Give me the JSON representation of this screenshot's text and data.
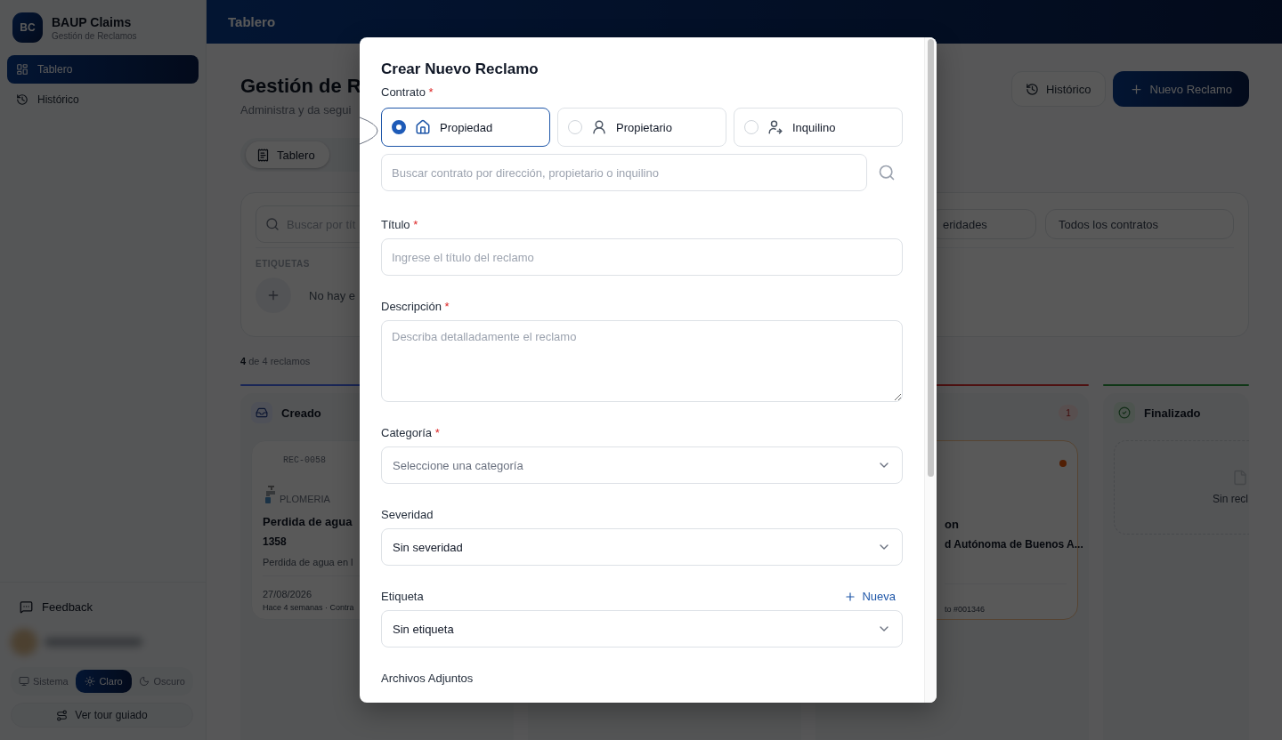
{
  "sidebar": {
    "logo": "BC",
    "app_name": "BAUP Claims",
    "app_subtitle": "Gestión de Reclamos",
    "nav": [
      {
        "label": "Tablero",
        "selected": true
      },
      {
        "label": "Histórico",
        "selected": false
      }
    ],
    "feedback": "Feedback",
    "theme_options": [
      {
        "label": "Sistema",
        "selected": false
      },
      {
        "label": "Claro",
        "selected": true
      },
      {
        "label": "Oscuro",
        "selected": false
      }
    ],
    "tour_button": "Ver tour guiado"
  },
  "header": {
    "title": "Tablero"
  },
  "page": {
    "title": "Gestión de R",
    "subtitle": "Administra y da segui",
    "actions": [
      {
        "label": "Histórico",
        "kind": "secondary"
      },
      {
        "label": "Nuevo Reclamo",
        "kind": "primary"
      }
    ],
    "view_tabs": [
      {
        "label": "Tablero",
        "selected": true
      }
    ],
    "filters": {
      "search_placeholder": "Buscar por tít",
      "chips": [
        "eridades",
        "Todos los contratos"
      ],
      "tags_heading": "ETIQUETAS",
      "tags_empty": "No hay e"
    },
    "count": "**4** de 4 reclamos",
    "columns": [
      {
        "title": "Creado",
        "kind": "created",
        "cards": [
          {
            "id": "REC-0058",
            "category": "PLOMERIA",
            "title": "Perdida de agua",
            "title_2": "1358",
            "description": "Perdida de agua en l",
            "date": "27/08/2026",
            "meta": "Hace 4 semanas · Contra"
          }
        ]
      },
      {},
      {
        "count": "1",
        "kind": "urgent",
        "cards": [
          {
            "title": "on",
            "title_2": "d Autónoma de Buenos A...",
            "meta": "to #001346",
            "kind": "flagged"
          }
        ]
      },
      {
        "title": "Finalizado",
        "kind": "done",
        "empty": "Sin recl"
      }
    ]
  },
  "modal": {
    "title": "Crear Nuevo Reclamo",
    "contract_label": "Contrato",
    "contract_required_mark": "*",
    "contract_options": [
      {
        "label": "Propiedad",
        "selected": true
      },
      {
        "label": "Propietario",
        "selected": false
      },
      {
        "label": "Inquilino",
        "selected": false
      }
    ],
    "contract_search_placeholder": "Buscar contrato por dirección, propietario o inquilino",
    "fields": [
      {
        "kind": "text",
        "label": "Título",
        "required_mark": "*",
        "placeholder": "Ingrese el título del reclamo"
      },
      {
        "kind": "textarea",
        "label": "Descripción",
        "required_mark": "*",
        "placeholder": "Describa detalladamente el reclamo"
      },
      {
        "kind": "select",
        "label": "Categoría",
        "required_mark": "*",
        "placeholder": "Seleccione una categoría"
      },
      {
        "kind": "select",
        "label": "Severidad",
        "value": "Sin severidad"
      },
      {
        "kind": "select",
        "label": "Etiqueta",
        "value": "Sin etiqueta",
        "action": "Nueva"
      },
      {
        "kind": "section",
        "label": "Archivos Adjuntos"
      }
    ]
  }
}
